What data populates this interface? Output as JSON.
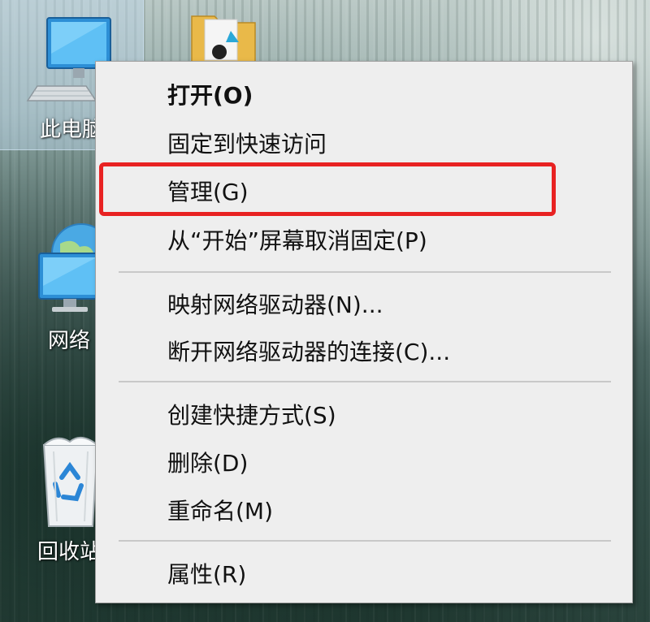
{
  "desktop": {
    "icons": [
      {
        "label": "此电脑",
        "icon": "computer-icon"
      },
      {
        "label": "网络",
        "icon": "network-globe-icon"
      },
      {
        "label": "回收站",
        "icon": "recycle-bin-icon"
      },
      {
        "label": "",
        "icon": "folder-icon"
      }
    ]
  },
  "context_menu": {
    "items": [
      {
        "label": "打开(O)",
        "bold": true
      },
      {
        "label": "固定到快速访问"
      },
      {
        "label": "管理(G)",
        "highlighted": true
      },
      {
        "label": "从“开始”屏幕取消固定(P)"
      },
      {
        "label": "映射网络驱动器(N)..."
      },
      {
        "label": "断开网络驱动器的连接(C)..."
      },
      {
        "label": "创建快捷方式(S)"
      },
      {
        "label": "删除(D)"
      },
      {
        "label": "重命名(M)"
      },
      {
        "label": "属性(R)"
      }
    ],
    "highlight_color": "#e82222",
    "background": "#eeeeee"
  }
}
